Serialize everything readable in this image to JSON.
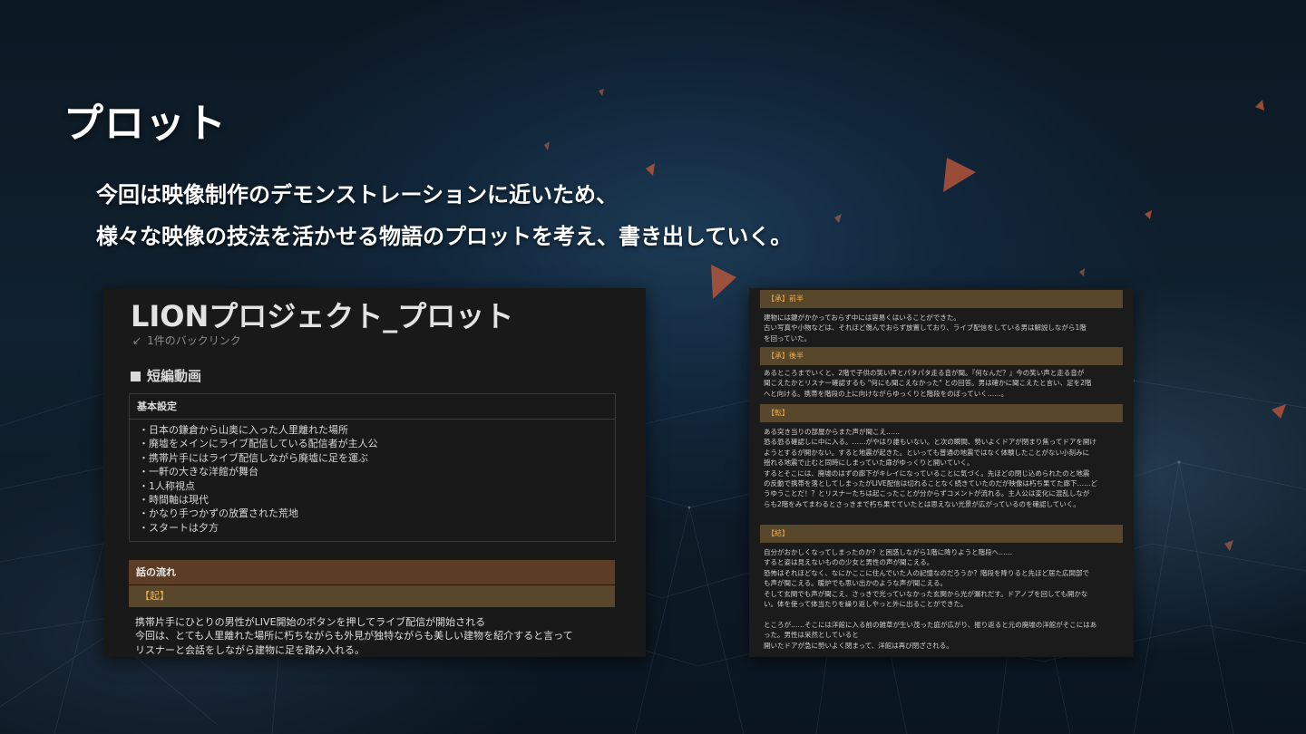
{
  "slide": {
    "title": "プロット",
    "intro": [
      "今回は映像制作のデモンストレーションに近いため、",
      "様々な映像の技法を活かせる物語のプロットを考え、書き出していく。"
    ]
  },
  "left_screenshot": {
    "doc_title": "LIONプロジェクト_プロット",
    "backlinks": "1件のバックリンク",
    "section_title": "短編動画",
    "settings_header": "基本設定",
    "settings": [
      "・日本の鎌倉から山奥に入った人里離れた場所",
      "・廃墟をメインにライブ配信している配信者が主人公",
      "・携帯片手にはライブ配信しながら廃墟に足を運ぶ",
      "・一軒の大きな洋館が舞台",
      "・1人称視点",
      "・時間軸は現代",
      "・かなり手つかずの放置された荒地",
      "・スタートは夕方"
    ],
    "flow_header": "話の流れ",
    "ki_label": "【起】",
    "ki_text": [
      "携帯片手にひとりの男性がLIVE開始のボタンを押してライブ配信が開始される",
      "今回は、とても人里離れた場所に朽ちながらも外見が独特ながらも美しい建物を紹介すると言って",
      "リスナーと会話をしながら建物に足を踏み入れる。"
    ]
  },
  "right_screenshot": {
    "sho_first_label": "【承】前半",
    "sho_first_text": [
      "建物には鍵がかかっておらず中には容易くはいることができた。",
      "古い写真や小物などは、それほど傷んでおらず放置しており、ライブ配信をしている男は解説しながら1階",
      "を回っていた。"
    ],
    "sho_second_label": "【承】後半",
    "sho_second_text": [
      "あるところまでいくと、2階で子供の笑い声とパタパタ走る音が聞。『何なんだ？』今の笑い声と走る音が",
      "聞こえたかとリスナー確認するも \"何にも聞こえなかった\" との回答。男は確かに聞こえたと言い、足を2階",
      "へと向ける。携帯を階段の上に向けながらゆっくりと階段をのぼっていく……。"
    ],
    "ten_label": "【転】",
    "ten_text": [
      "ある突き当りの部屋からまた声が聞こえ……",
      "恐る恐る確認しに中に入る。……がやはり誰もいない。と次の瞬間、勢いよくドアが閉まり焦ってドアを開け",
      "ようとするが開かない。すると地震が起きた。といっても普通の地震ではなく体験したことがない小刻みに",
      "揺れる地震で止むと同時にしまっていた扉がゆっくりと開いていく。",
      "するとそこには、廃墟のはずの廊下がキレイになっていることに気づく。先ほどの閉じ込められたのと地震",
      "の反動で携帯を落としてしまったがLIVE配信は切れることなく続きていたのだが映像は朽ち果てた廊下……ど",
      "うゆうことだ！？とリスナーたちは起こったことが分からずコメントが流れる。主人公は変化に混乱しなが",
      "らも2階をみてまわるとさっきまで朽ち果てていたとは思えない光景が広がっているのを確認していく。"
    ],
    "ketsu_label": "【結】",
    "ketsu_text": [
      "自分がおかしくなってしまったのか？と困惑しながら1階に降りようと階段へ……",
      "すると姿は見えないものの少女と男性の声が聞こえる。",
      "恐怖はそれほどなく、なにかここに住んでいた人の記憶なのだろうか？階段を降りると先ほど居た広間部で",
      "も声が聞こえる。暖炉でも思い出かのような声が聞こえる。",
      "そして玄関でも声が聞こえ、さっきで光っていなかった玄関から光が漏れだす。ドアノブを回しても開かな",
      "い。体を使って体当たりを繰り返しやっと外に出ることができた。",
      "",
      "ところが……そこには洋館に入る前の雑草が生い茂った庭が広がり、振り返ると元の廃墟の洋館がそこにはあ",
      "った。男性は呆然としていると",
      "開いたドアが急に勢いよく閉まって、洋館は再び閉ざされる。"
    ]
  }
}
